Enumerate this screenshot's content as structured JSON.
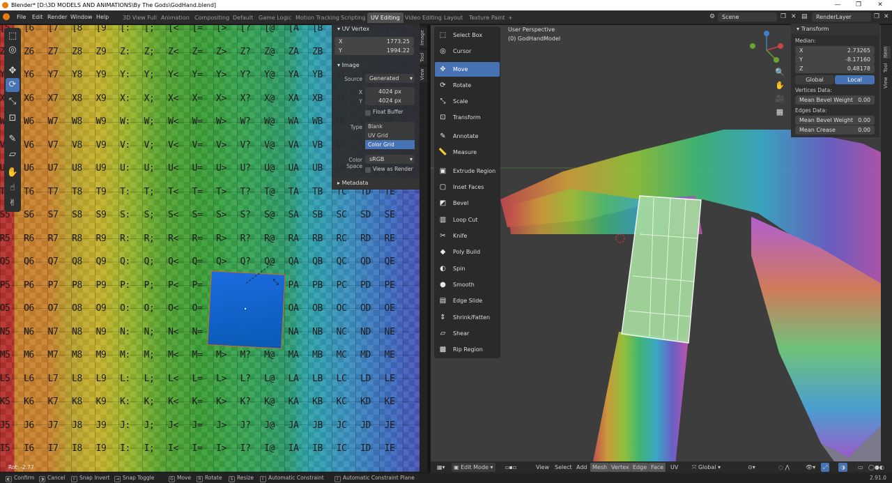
{
  "window": {
    "title": "Blender* [D:\\3D MODELS AND ANIMATIONS\\By The Gods\\GodHand.blend]",
    "minimize": "—",
    "maximize": "❐",
    "close": "✕"
  },
  "menu": [
    "File",
    "Edit",
    "Render",
    "Window",
    "Help"
  ],
  "workspaces": [
    "3D View Full",
    "Animation",
    "Compositing",
    "Default",
    "Game Logic",
    "Motion Tracking",
    "Scripting",
    "UV Editing",
    "Video Editing",
    "Layout",
    "Texture Paint"
  ],
  "active_workspace": "UV Editing",
  "add_tab": "+",
  "scene": {
    "label": "Scene",
    "view_layer": "RenderLayer"
  },
  "uv_grid": {
    "rows": [
      "[",
      "Z",
      "Y",
      "X",
      "W",
      "V",
      "U",
      "T",
      "S",
      "R",
      "Q",
      "P",
      "O",
      "N",
      "M",
      "L",
      "K",
      "J",
      "I"
    ],
    "cols": [
      "5",
      "6",
      "7",
      "8",
      "9",
      ":",
      ";",
      "<",
      "=",
      ">",
      "?",
      "@",
      "A",
      "B",
      "C",
      "D",
      "E"
    ],
    "row_labels": {
      "Q": [
        "Q5",
        "Q6",
        "Q7",
        "Q8",
        "Q9",
        "Q:",
        "Q;",
        "Q<",
        "Q=",
        "Q>",
        "Q?",
        "Q@",
        "QA",
        "QB",
        "QC",
        "QD",
        "QE"
      ]
    }
  },
  "uv_vertex": {
    "header": "UV Vertex",
    "x_label": "X",
    "x": "1773.25",
    "y_label": "Y",
    "y": "1994.22"
  },
  "image_panel": {
    "header": "Image",
    "source_label": "Source",
    "source": "Generated",
    "x_label": "X",
    "width": "4024 px",
    "y_label": "Y",
    "height": "4024 px",
    "float_buffer": "Float Buffer",
    "type_label": "Type",
    "types": [
      "Blank",
      "UV Grid",
      "Color Grid"
    ],
    "selected_type": "Color Grid",
    "color_space_label": "Color Space",
    "color_space": "sRGB",
    "view_as_render": "View as Render",
    "metadata": "Metadata"
  },
  "uv_sidetabs": [
    "Image",
    "Tool",
    "View"
  ],
  "uv_status": "Rot: -2.77",
  "viewport": {
    "perspective": "User Perspective",
    "object": "(0) GodHandModel"
  },
  "vp_tools": [
    {
      "label": "Select Box",
      "icon": "⬚"
    },
    {
      "label": "Cursor",
      "icon": "◎"
    },
    {
      "label": "Move",
      "icon": "✥"
    },
    {
      "label": "Rotate",
      "icon": "⟳"
    },
    {
      "label": "Scale",
      "icon": "⤡"
    },
    {
      "label": "Transform",
      "icon": "⊡"
    },
    {
      "label": "Annotate",
      "icon": "✎"
    },
    {
      "label": "Measure",
      "icon": "📏"
    },
    {
      "label": "Extrude Region",
      "icon": "▣"
    },
    {
      "label": "Inset Faces",
      "icon": "▢"
    },
    {
      "label": "Bevel",
      "icon": "◩"
    },
    {
      "label": "Loop Cut",
      "icon": "▥"
    },
    {
      "label": "Knife",
      "icon": "✂"
    },
    {
      "label": "Poly Build",
      "icon": "◆"
    },
    {
      "label": "Spin",
      "icon": "◐"
    },
    {
      "label": "Smooth",
      "icon": "●"
    },
    {
      "label": "Edge Slide",
      "icon": "▤"
    },
    {
      "label": "Shrink/Fatten",
      "icon": "⇕"
    },
    {
      "label": "Shear",
      "icon": "▱"
    },
    {
      "label": "Rip Region",
      "icon": "▩"
    }
  ],
  "active_vp_tool": "Move",
  "transform": {
    "header": "Transform",
    "median": "Median:",
    "x_label": "X",
    "x": "2.73265",
    "y_label": "Y",
    "y": "-8.17160",
    "z_label": "Z",
    "z": "0.48178",
    "global": "Global",
    "local": "Local",
    "vertices_data": "Vertices Data:",
    "mean_bevel_weight_v": "Mean Bevel Weight",
    "mbw_v_val": "0.00",
    "edges_data": "Edges Data:",
    "mean_bevel_weight_e": "Mean Bevel Weight",
    "mbw_e_val": "0.00",
    "mean_crease": "Mean Crease",
    "mc_val": "0.00"
  },
  "vp_sidetabs": [
    "Item",
    "Tool",
    "View"
  ],
  "vp_header": {
    "mode": "Edit Mode",
    "menus": [
      "View",
      "Select",
      "Add",
      "Mesh",
      "Vertex",
      "Edge",
      "Face",
      "UV"
    ],
    "active_menus": [
      "Mesh",
      "Vertex",
      "Edge",
      "Face"
    ],
    "orientation": "Global"
  },
  "statusbar": [
    {
      "key": "◐",
      "label": "Confirm"
    },
    {
      "key": "◑",
      "label": "Cancel"
    },
    {
      "key": "⇧",
      "label": "Snap Invert"
    },
    {
      "key": "⇥",
      "label": "Snap Toggle"
    },
    {
      "key": "G",
      "label": "Move"
    },
    {
      "key": "R",
      "label": "Rotate"
    },
    {
      "key": "S",
      "label": "Resize"
    },
    {
      "key": "⇧",
      "label": "Automatic Constraint"
    },
    {
      "key": "⇧",
      "label": "Automatic Constraint Plane"
    }
  ],
  "version": "2.91.0"
}
